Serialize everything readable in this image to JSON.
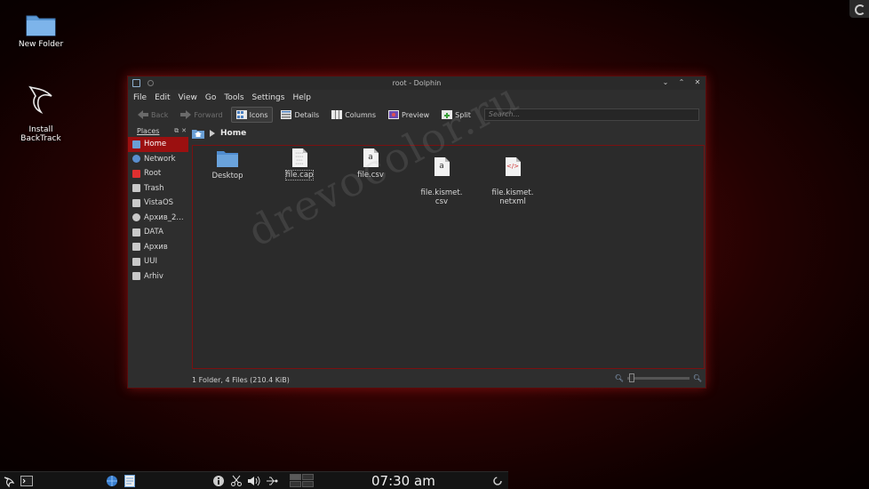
{
  "desktop": {
    "icons": [
      {
        "label": "New Folder",
        "icon": "folder-icon"
      },
      {
        "label": "Install\nBackTrack",
        "icon": "backtrack-dragon-icon"
      }
    ]
  },
  "window": {
    "title": "root - Dolphin",
    "menu": [
      "File",
      "Edit",
      "View",
      "Go",
      "Tools",
      "Settings",
      "Help"
    ],
    "toolbar": {
      "back": "Back",
      "forward": "Forward",
      "icons": "Icons",
      "details": "Details",
      "columns": "Columns",
      "preview": "Preview",
      "split": "Split",
      "search_placeholder": "Search..."
    },
    "places": {
      "header": "Places",
      "items": [
        {
          "label": "Home",
          "color": "#6a9fd4",
          "selected": true
        },
        {
          "label": "Network",
          "color": "#5a8fd0"
        },
        {
          "label": "Root",
          "color": "#e03030"
        },
        {
          "label": "Trash",
          "color": "#c8c8c8"
        },
        {
          "label": "VistaOS",
          "color": "#c8c8c8"
        },
        {
          "label": "Архив_2...",
          "color": "#c8c8c8"
        },
        {
          "label": "DATA",
          "color": "#c8c8c8"
        },
        {
          "label": "Архив",
          "color": "#c8c8c8"
        },
        {
          "label": "UUI",
          "color": "#c8c8c8"
        },
        {
          "label": "Arhiv",
          "color": "#c8c8c8"
        }
      ]
    },
    "breadcrumb": "Home",
    "files": [
      {
        "name": "Desktop",
        "type": "folder"
      },
      {
        "name": "file.cap",
        "type": "binary"
      },
      {
        "name": "file.csv",
        "type": "text",
        "glyph": "a"
      },
      {
        "name": "file.kismet.\ncsv",
        "type": "text",
        "glyph": "a"
      },
      {
        "name": "file.kismet.\nnetxml",
        "type": "xml",
        "glyph": "</>"
      }
    ],
    "status": "1 Folder, 4 Files (210.4 KiB)"
  },
  "watermark": "drevocolor.ru",
  "taskbar": {
    "clock": "07:30 am"
  },
  "colors": {
    "accent": "#9b1010",
    "folder": "#6aa3dc"
  }
}
